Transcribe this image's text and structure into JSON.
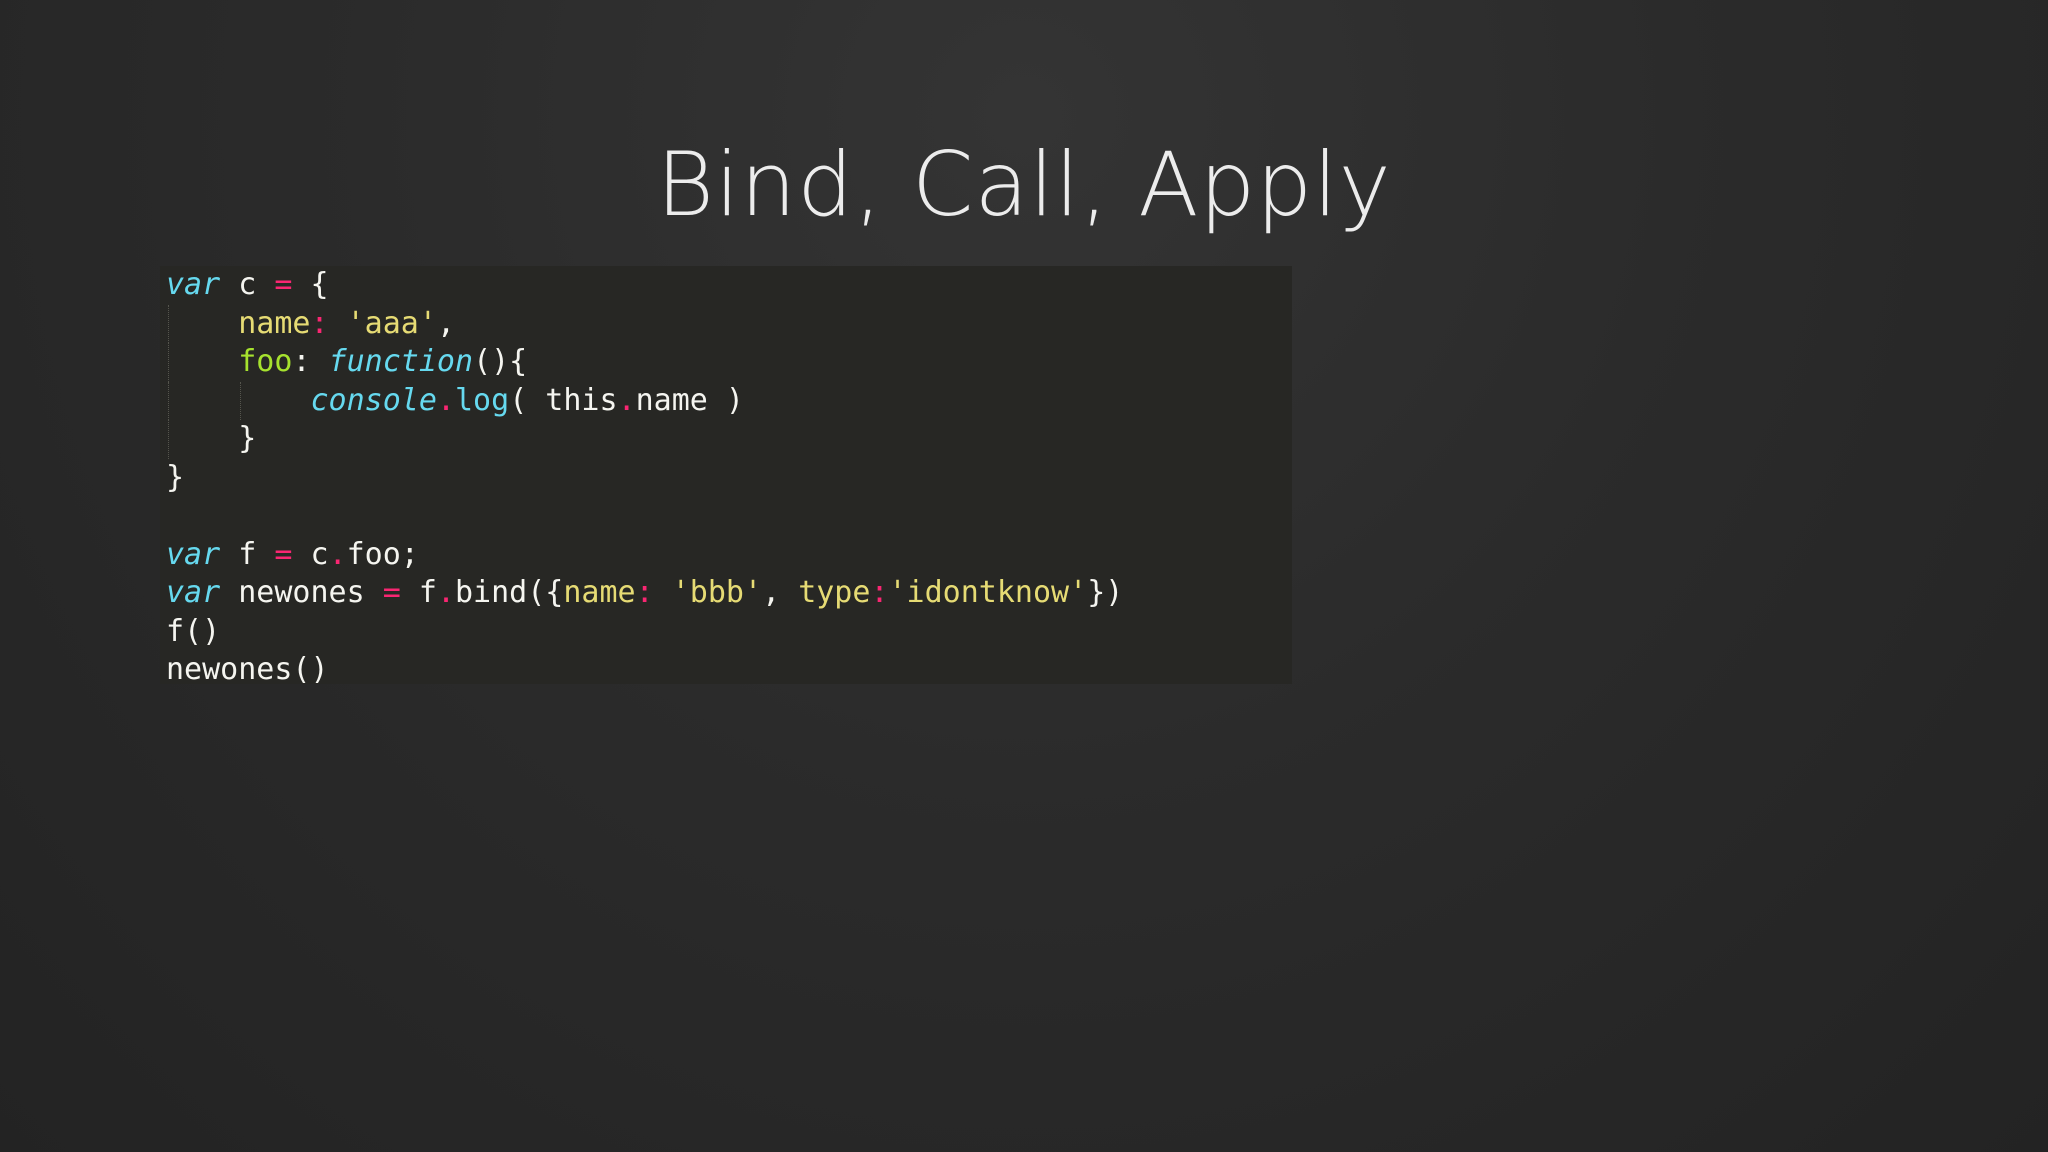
{
  "slide": {
    "title": "Bind, Call, Apply"
  },
  "code": {
    "lines": [
      [
        {
          "t": "var",
          "c": "kw"
        },
        {
          "t": " c ",
          "c": ""
        },
        {
          "t": "=",
          "c": "op"
        },
        {
          "t": " {",
          "c": ""
        }
      ],
      [
        {
          "t": "    ",
          "c": ""
        },
        {
          "t": "name",
          "c": "str"
        },
        {
          "t": ":",
          "c": "op"
        },
        {
          "t": " ",
          "c": ""
        },
        {
          "t": "'aaa'",
          "c": "str"
        },
        {
          "t": ",",
          "c": ""
        }
      ],
      [
        {
          "t": "    ",
          "c": ""
        },
        {
          "t": "foo",
          "c": "prop"
        },
        {
          "t": ": ",
          "c": ""
        },
        {
          "t": "function",
          "c": "kw"
        },
        {
          "t": "(){",
          "c": ""
        }
      ],
      [
        {
          "t": "        ",
          "c": ""
        },
        {
          "t": "console",
          "c": "kw"
        },
        {
          "t": ".",
          "c": "op"
        },
        {
          "t": "log",
          "c": "fn"
        },
        {
          "t": "( this",
          "c": ""
        },
        {
          "t": ".",
          "c": "op"
        },
        {
          "t": "name )",
          "c": ""
        }
      ],
      [
        {
          "t": "    }",
          "c": ""
        }
      ],
      [
        {
          "t": "}",
          "c": ""
        }
      ],
      [
        {
          "t": "",
          "c": ""
        }
      ],
      [
        {
          "t": "var",
          "c": "kw"
        },
        {
          "t": " f ",
          "c": ""
        },
        {
          "t": "=",
          "c": "op"
        },
        {
          "t": " c",
          "c": ""
        },
        {
          "t": ".",
          "c": "op"
        },
        {
          "t": "foo;",
          "c": ""
        }
      ],
      [
        {
          "t": "var",
          "c": "kw"
        },
        {
          "t": " newones ",
          "c": ""
        },
        {
          "t": "=",
          "c": "op"
        },
        {
          "t": " f",
          "c": ""
        },
        {
          "t": ".",
          "c": "op"
        },
        {
          "t": "bind({",
          "c": ""
        },
        {
          "t": "name",
          "c": "str"
        },
        {
          "t": ":",
          "c": "op"
        },
        {
          "t": " ",
          "c": ""
        },
        {
          "t": "'bbb'",
          "c": "str"
        },
        {
          "t": ", ",
          "c": ""
        },
        {
          "t": "type",
          "c": "str"
        },
        {
          "t": ":",
          "c": "op"
        },
        {
          "t": "'idontknow'",
          "c": "str"
        },
        {
          "t": "})",
          "c": ""
        }
      ],
      [
        {
          "t": "f()",
          "c": ""
        }
      ],
      [
        {
          "t": "newones()",
          "c": ""
        }
      ]
    ]
  }
}
